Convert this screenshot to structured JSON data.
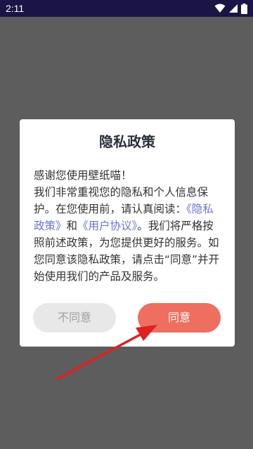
{
  "status_bar": {
    "time": "2:11",
    "icons": [
      "wifi-icon",
      "signal-icon",
      "battery-icon"
    ]
  },
  "dialog": {
    "title": "隐私政策",
    "greeting": "感谢您使用壁纸喵！",
    "body_part1": "我们非常重视您的隐私和个人信息保护。在您使用前，请认真阅读：",
    "privacy_link": "《隐私政策》",
    "and_text": "和",
    "user_agreement_link": "《用户协议》",
    "body_part2": "。我们将严格按照前述政策，为您提供更好的服务。如您同意该隐私政策，请点击“同意”并开始使用我们的产品及服务。",
    "disagree_label": "不同意",
    "agree_label": "同意"
  },
  "colors": {
    "status_bar": "#1b1546",
    "overlay": "#5d5d5d",
    "agree_button": "#ee6e60",
    "disagree_button": "#e8e8e8",
    "link": "#6b73d6",
    "arrow": "#e02020"
  }
}
